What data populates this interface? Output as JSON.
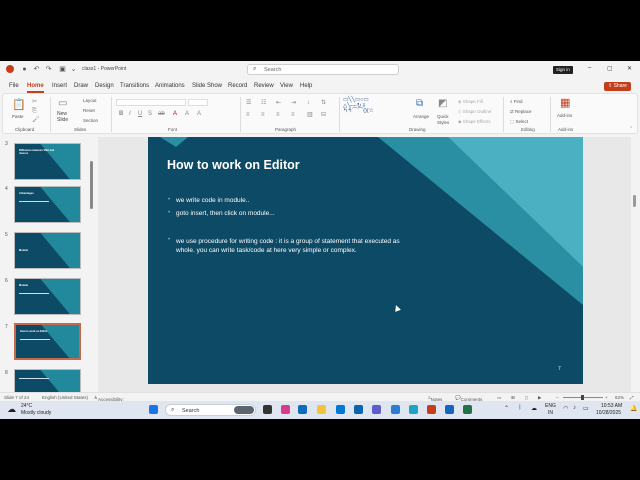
{
  "window": {
    "filename": "class1",
    "separator": "-",
    "app_name": "PowerPoint",
    "search_placeholder": "Search",
    "signin_label": "Sign in",
    "minimize": "–",
    "restore": "▢",
    "close": "✕"
  },
  "menu": {
    "tabs": [
      "File",
      "Home",
      "Insert",
      "Draw",
      "Design",
      "Transitions",
      "Animations",
      "Slide Show",
      "Record",
      "Review",
      "View",
      "Help"
    ],
    "active": "Home",
    "share_label": "Share"
  },
  "ribbon": {
    "groups": {
      "clipboard": "Clipboard",
      "slides": "Slides",
      "font": "Font",
      "paragraph": "Paragraph",
      "drawing": "Drawing",
      "editing": "Editing",
      "addins": "Add-ins"
    },
    "paste": "Paste",
    "new_slide_line1": "New",
    "new_slide_line2": "Slide",
    "layout": "Layout",
    "reset": "Reset",
    "section": "Section",
    "arrange": "Arrange",
    "quick_styles_line1": "Quick",
    "quick_styles_line2": "Styles",
    "shape_fill": "Shape Fill",
    "shape_outline": "Shape Outline",
    "shape_effects": "Shape Effects",
    "find": "Find",
    "replace": "Replace",
    "select": "Select",
    "addins_btn": "Add-ins"
  },
  "thumbnails": [
    {
      "num": "3",
      "title": "Difference between VBA and macros"
    },
    {
      "num": "4",
      "title": "Advantages"
    },
    {
      "num": "5",
      "title": "Module"
    },
    {
      "num": "6",
      "title": "Module"
    },
    {
      "num": "7",
      "title": "How to work on Editor"
    },
    {
      "num": "8",
      "title": ""
    }
  ],
  "slide": {
    "title": "How to work on Editor",
    "bullets": [
      "we write code in module..",
      "goto insert, then click on module...",
      "we use procedure for writing code : it is a group of statement that executed as whole. you can write task/code at here very simple or complex."
    ],
    "page_number": "7"
  },
  "status": {
    "slide_info": "Slide 7 of 24",
    "language": "English (United States)",
    "accessibility": "Accessibility: Good to go",
    "notes": "Notes",
    "comments": "Comments",
    "zoom": "62%"
  },
  "taskbar": {
    "temperature": "24°C",
    "weather": "Mostly cloudy",
    "search_placeholder": "Search",
    "lang_line1": "ENG",
    "lang_line2": "IN",
    "time": "10:53 AM",
    "date": "10/28/2025"
  },
  "colors": {
    "accent": "#c43e1c",
    "slide_bg": "#0d4a66",
    "slide_band": "#2a9fb0"
  }
}
